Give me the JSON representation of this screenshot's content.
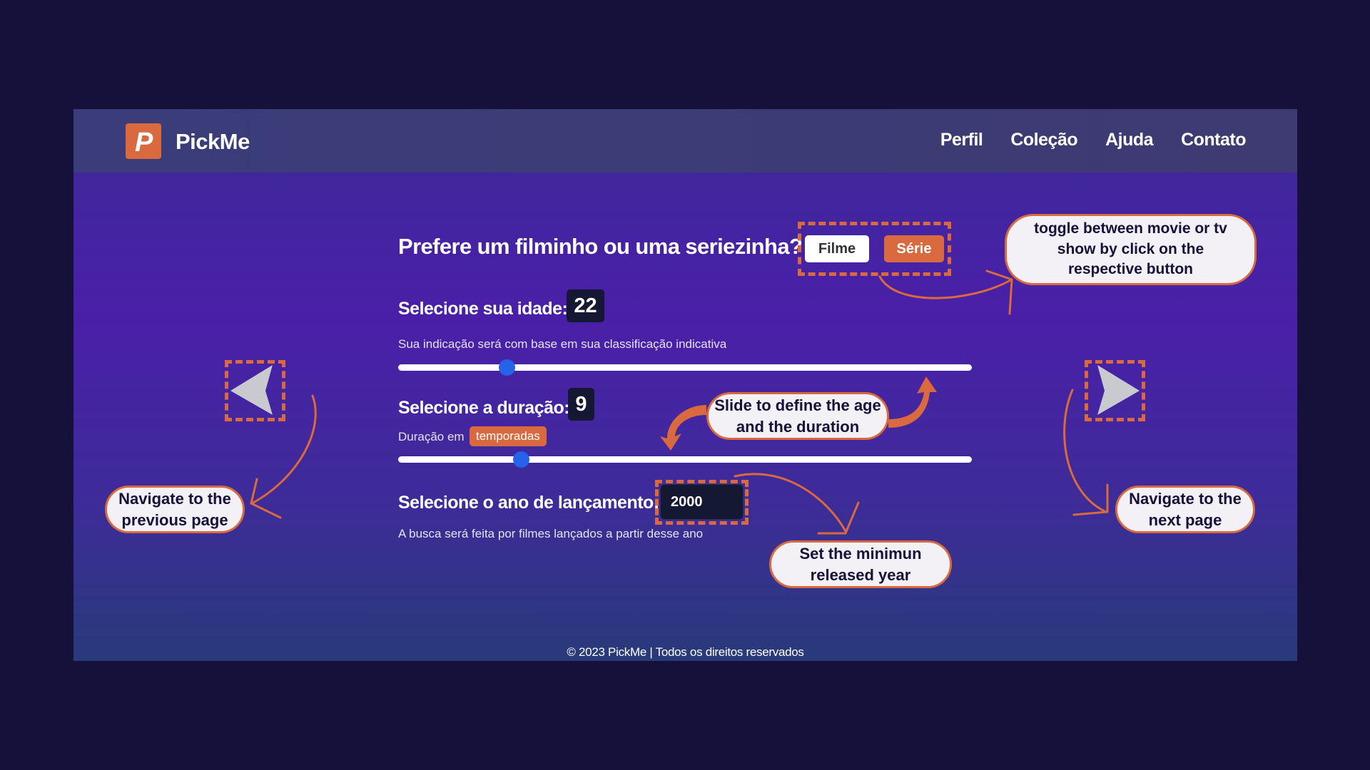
{
  "navbar": {
    "logo_letter": "P",
    "brand": "PickMe",
    "links": [
      "Perfil",
      "Coleção",
      "Ajuda",
      "Contato"
    ]
  },
  "question": {
    "title": "Prefere um filminho ou uma seriezinha?",
    "options": [
      "Filme",
      "Série"
    ],
    "selected": "Série"
  },
  "age": {
    "label": "Selecione sua idade:",
    "value": "22",
    "hint": "Sua indicação será com base em sua classificação indicativa",
    "slider_fraction": 0.19
  },
  "duration": {
    "label": "Selecione a duração:",
    "value": "9",
    "hint_prefix": "Duração em",
    "unit_tag": "temporadas",
    "slider_fraction": 0.215
  },
  "year": {
    "label": "Selecione o ano de lançamento:",
    "value": "2000",
    "hint": "A busca será feita por filmes lançados a partir desse ano"
  },
  "footer": "© 2023 PickMe | Todos os direitos reservados",
  "annotations": {
    "toggle": "toggle between movie or tv show by click on the respective button",
    "slide": "Slide to define the age and the duration",
    "year": "Set the minimun released year",
    "prev": "Navigate to the previous page",
    "next": "Navigate to the next page"
  },
  "colors": {
    "accent": "#d9693f",
    "slider_thumb": "#2563eb",
    "page_background": "#15113a"
  },
  "icons": {
    "prev": "triangle-left-arrow",
    "next": "triangle-right-arrow"
  }
}
